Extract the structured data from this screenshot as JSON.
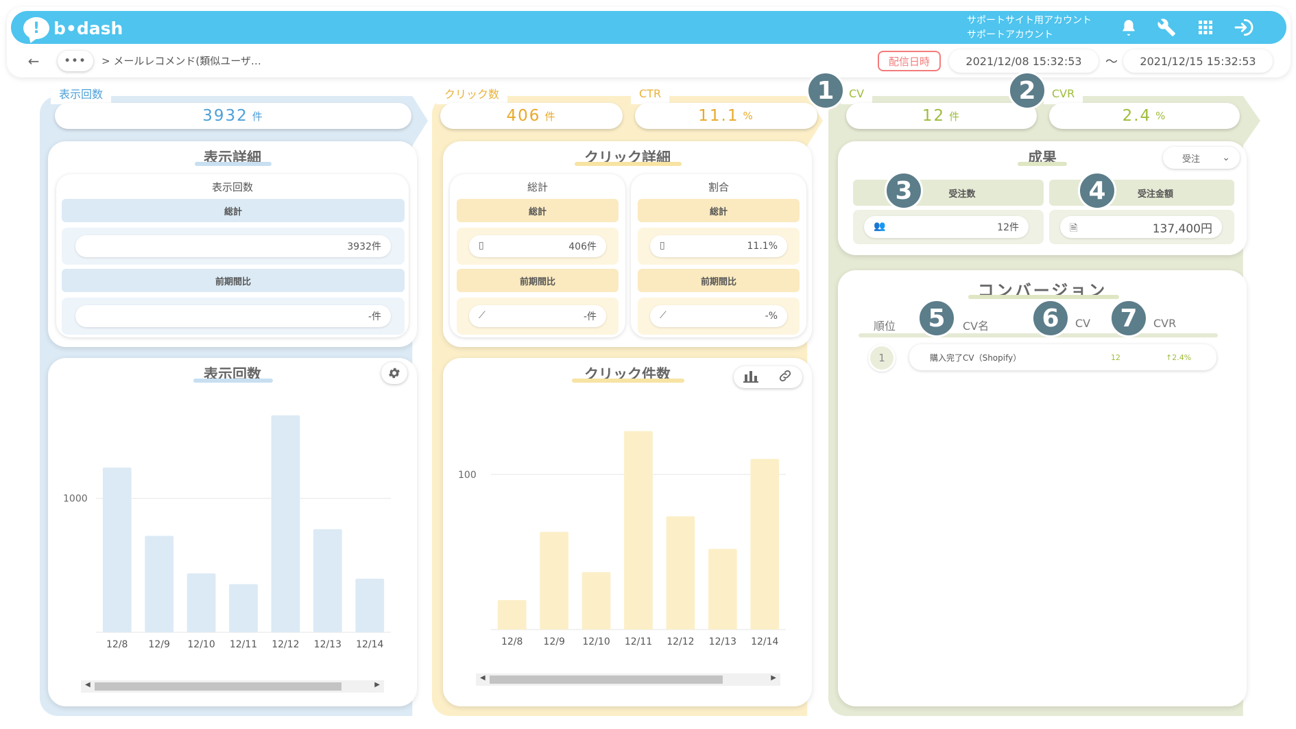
{
  "header": {
    "logo_text": "b•dash",
    "logo_mark": "!",
    "account_line1": "サポートサイト用アカウント",
    "account_line2": "サポートアカウント",
    "icons": [
      "bell-icon",
      "wrench-icon",
      "grid-icon",
      "logout-icon"
    ],
    "brand_color": "#4ec4ee"
  },
  "nav": {
    "back_icon": "←",
    "more_label": "•••",
    "breadcrumb": "> メールレコメンド(類似ユーザ…",
    "date_label": "配信日時",
    "date_from": "2021/12/08 15:32:53",
    "date_sep": "〜",
    "date_to": "2021/12/15 15:32:53"
  },
  "metrics": {
    "impressions": {
      "label": "表示回数",
      "value": "3932",
      "unit": "件"
    },
    "clicks": {
      "label": "クリック数",
      "value": "406",
      "unit": "件"
    },
    "ctr": {
      "label": "CTR",
      "value": "11.1",
      "unit": "%"
    },
    "cv": {
      "label": "CV",
      "value": "12",
      "unit": "件"
    },
    "cvr": {
      "label": "CVR",
      "value": "2.4",
      "unit": "%"
    }
  },
  "annotations": [
    "1",
    "2",
    "3",
    "4",
    "5",
    "6",
    "7"
  ],
  "impression_detail": {
    "title": "表示詳細",
    "sub_title": "表示回数",
    "total_label": "総計",
    "total_value": "3932件",
    "prev_label": "前期間比",
    "prev_value": "-件"
  },
  "click_detail": {
    "title": "クリック詳細",
    "left": {
      "title": "総計",
      "total_label": "総計",
      "total_value": "406件",
      "prev_label": "前期間比",
      "prev_value": "-件"
    },
    "right": {
      "title": "割合",
      "total_label": "総計",
      "total_value": "11.1%",
      "prev_label": "前期間比",
      "prev_value": "-%"
    }
  },
  "results": {
    "title": "成果",
    "select_value": "受注",
    "orders": {
      "label": "受注数",
      "value": "12件"
    },
    "amount": {
      "label": "受注金額",
      "value": "137,400円"
    }
  },
  "conversion": {
    "title": "コンバージョン",
    "columns": [
      "順位",
      "CV名",
      "CV",
      "CVR"
    ],
    "rows": [
      {
        "rank": "1",
        "name": "購入完了CV（Shopify）",
        "cv": "12",
        "cvr": "↑2.4%"
      }
    ]
  },
  "chart_titles": {
    "impressions": "表示回数",
    "clicks": "クリック件数"
  },
  "chart_data": [
    {
      "type": "bar",
      "title": "表示回数",
      "categories": [
        "12/8",
        "12/9",
        "12/10",
        "12/11",
        "12/12",
        "12/13",
        "12/14"
      ],
      "values": [
        1230,
        720,
        440,
        360,
        1620,
        770,
        400
      ],
      "ylim": [
        0,
        1700
      ],
      "ytick": 1000,
      "grid": true,
      "color": "#dceaf5"
    },
    {
      "type": "bar",
      "title": "クリック件数",
      "categories": [
        "12/8",
        "12/9",
        "12/10",
        "12/11",
        "12/12",
        "12/13",
        "12/14"
      ],
      "values": [
        19,
        63,
        37,
        128,
        73,
        52,
        110
      ],
      "ylim": [
        0,
        145
      ],
      "ytick": 100,
      "grid": true,
      "color": "#fcefc8"
    }
  ]
}
